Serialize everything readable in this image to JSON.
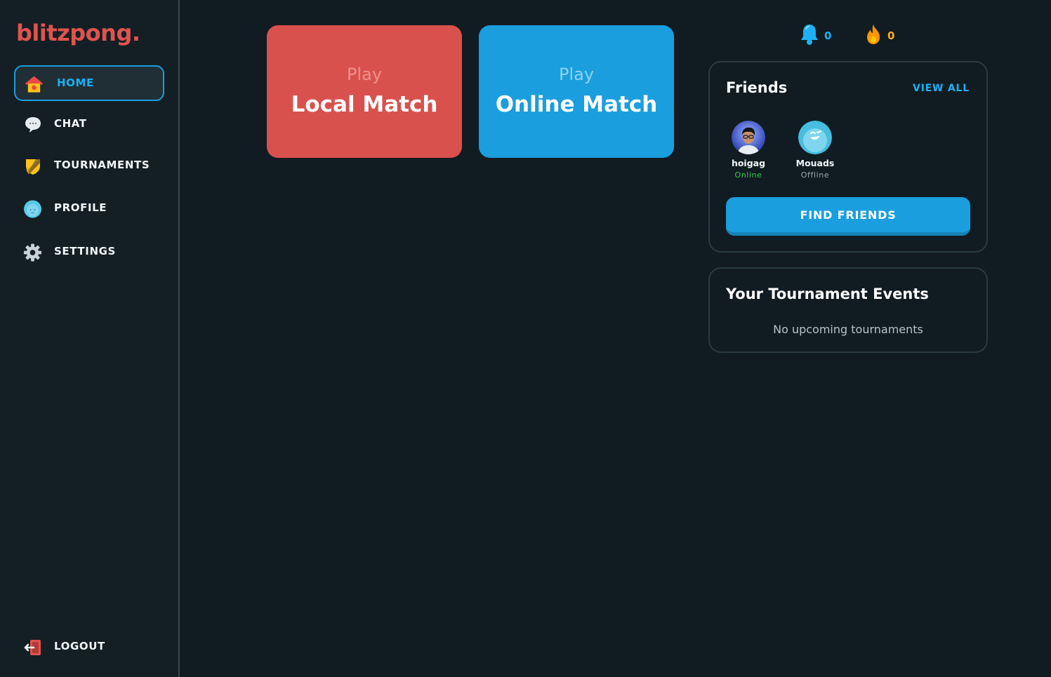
{
  "brand": {
    "logo_text": "blitzpong."
  },
  "sidebar": {
    "items": [
      {
        "label": "HOME",
        "icon": "home-icon",
        "active": true
      },
      {
        "label": "CHAT",
        "icon": "chat-bubble-icon",
        "active": false
      },
      {
        "label": "TOURNAMENTS",
        "icon": "shield-icon",
        "active": false
      },
      {
        "label": "PROFILE",
        "icon": "profile-face-icon",
        "active": false
      },
      {
        "label": "SETTINGS",
        "icon": "gear-icon",
        "active": false
      }
    ],
    "logout_label": "LOGOUT",
    "logout_icon": "logout-icon"
  },
  "play": {
    "local": {
      "small": "Play",
      "big": "Local Match"
    },
    "online": {
      "small": "Play",
      "big": "Online Match"
    }
  },
  "stats": {
    "notifications": {
      "icon": "bell-icon",
      "value": "0"
    },
    "streak": {
      "icon": "flame-icon",
      "value": "0"
    }
  },
  "friends_panel": {
    "title": "Friends",
    "view_all": "VIEW ALL",
    "friends": [
      {
        "name": "hoigag",
        "status": "Online",
        "avatar": "photo-avatar"
      },
      {
        "name": "Mouads",
        "status": "Offline",
        "avatar": "smiley-avatar"
      }
    ],
    "find_button": "FIND FRIENDS"
  },
  "tournament_panel": {
    "title": "Your Tournament Events",
    "empty_message": "No upcoming tournaments"
  },
  "colors": {
    "background": "#111c22",
    "accent_blue": "#1a9ede",
    "accent_red": "#d9514d",
    "online_green": "#3cc84a",
    "streak_orange": "#ffb020"
  }
}
